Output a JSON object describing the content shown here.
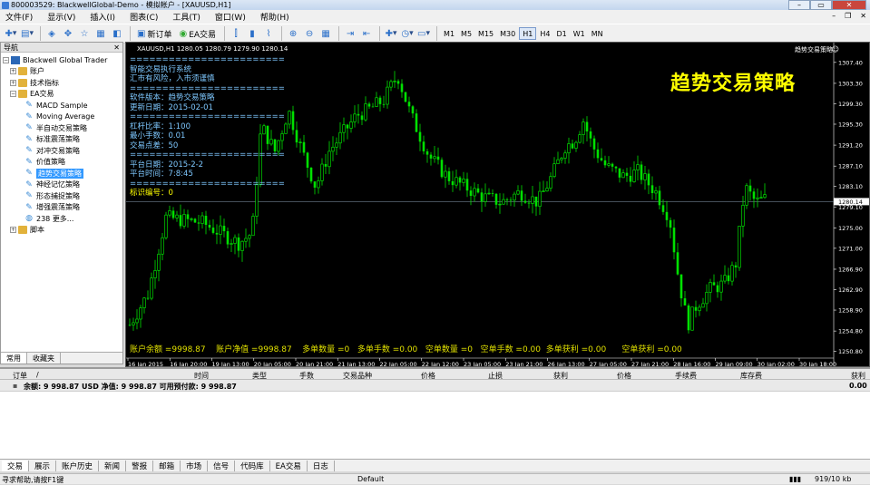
{
  "window": {
    "title": "800003529: BlackwellGlobal-Demo - 模拟帐户 - [XAUUSD,H1]"
  },
  "menu": [
    "文件(F)",
    "显示(V)",
    "插入(I)",
    "图表(C)",
    "工具(T)",
    "窗口(W)",
    "帮助(H)"
  ],
  "toolbar": {
    "new_order": "新订单",
    "ea_trading": "EA交易",
    "timeframes": [
      "M1",
      "M5",
      "M15",
      "M30",
      "H1",
      "H4",
      "D1",
      "W1",
      "MN"
    ],
    "active_timeframe": "H1"
  },
  "navigator": {
    "title": "导航",
    "root": "Blackwell Global Trader",
    "items": [
      "账户",
      "技术指标",
      "EA交易"
    ],
    "ea_items": [
      "MACD Sample",
      "Moving Average",
      "半自动交易策略",
      "标准震荡策略",
      "对冲交易策略",
      "价值策略",
      "趋势交易策略",
      "神经记忆策略",
      "形态捕捉策略",
      "增强震荡策略",
      "238 更多..."
    ],
    "selected": "趋势交易策略",
    "scripts": "脚本",
    "tabs": [
      "常用",
      "收藏夹"
    ]
  },
  "chart": {
    "symbol_line": "XAUUSD,H1  1280.05 1280.79 1279.90 1280.14",
    "ea_label": "趋势交易策略",
    "big_title": "趋势交易策略",
    "info_lines": [
      "========================",
      "智能交易执行系统",
      "汇市有风险，入市须谨慎",
      "========================",
      "软件版本：趋势交易策略",
      "更新日期：2015-02-01",
      "========================",
      "杠杆比率：1:100",
      "最小手数：0.01",
      "交易点差：50",
      "========================",
      "平台日期：2015-2-2",
      "平台时间：7:8:45",
      "========================"
    ],
    "id_label": "标识编号：",
    "id_value": "0",
    "bottom_info": "账户余额 =9998.87    账户净值 =9998.87    多单数量 =0   多单手数 =0.00   空单数量 =0   空单手数 =0.00  多单获利 =0.00      空单获利 =0.00",
    "colors": {
      "bull": "#00e000",
      "bear": "#00e000",
      "bg": "#000000"
    }
  },
  "chart_data": {
    "type": "candlestick",
    "y_ticks": [
      1307.4,
      1303.3,
      1299.3,
      1295.3,
      1291.2,
      1287.1,
      1283.1,
      1279.1,
      1275.0,
      1271.0,
      1266.9,
      1262.9,
      1258.9,
      1254.8,
      1250.8
    ],
    "current_price": 1280.14,
    "x_ticks": [
      "16 Jan 2015",
      "16 Jan 20:00",
      "19 Jan 13:00",
      "20 Jan 05:00",
      "20 Jan 21:00",
      "21 Jan 13:00",
      "22 Jan 05:00",
      "22 Jan 12:00",
      "23 Jan 05:00",
      "23 Jan 21:00",
      "26 Jan 13:00",
      "27 Jan 05:00",
      "27 Jan 21:00",
      "28 Jan 16:00",
      "29 Jan 09:00",
      "30 Jan 02:00",
      "30 Jan 18:00"
    ],
    "ylim": [
      1249.5,
      1309.5
    ]
  },
  "terminal": {
    "columns": [
      "订单",
      "/",
      "时间",
      "类型",
      "手数",
      "交易品种",
      "价格",
      "止损",
      "获利",
      "价格",
      "手续费",
      "库存费",
      "获利"
    ],
    "balance_line": "余额: 9 998.87 USD  净值: 9 998.87  可用预付款: 9 998.87",
    "total": "0.00"
  },
  "terminal_tabs": [
    "交易",
    "展示",
    "账户历史",
    "新闻",
    "警报",
    "邮箱",
    "市场",
    "信号",
    "代码库",
    "EA交易",
    "日志"
  ],
  "status": {
    "help": "寻求帮助,请按F1键",
    "profile": "Default",
    "traffic": "919/10 kb"
  }
}
